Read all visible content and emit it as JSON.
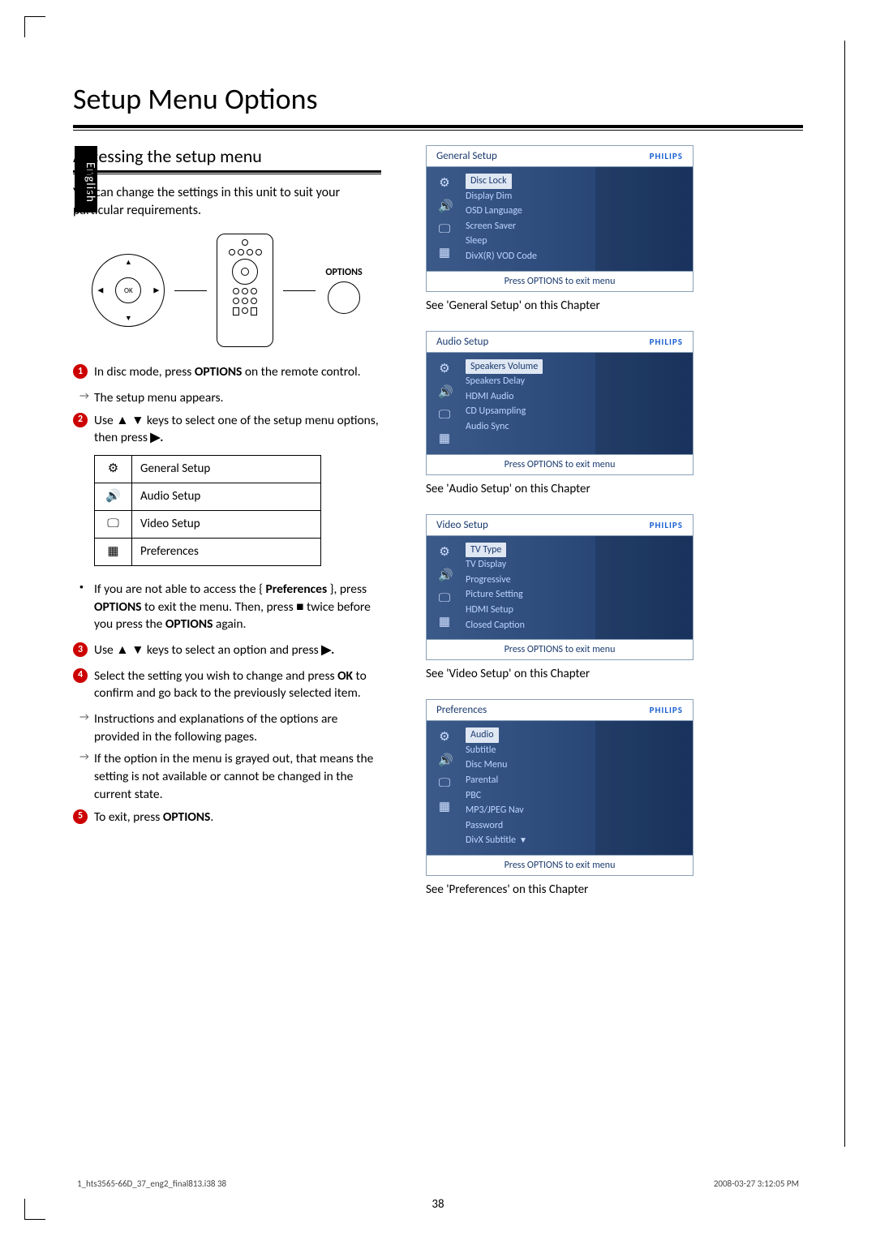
{
  "language_tab": "English",
  "page_title": "Setup Menu Options",
  "section_heading": "Accessing the setup menu",
  "intro_text": "You can change the settings in this unit to suit your particular requirements.",
  "remote": {
    "ok_label": "OK",
    "options_label": "OPTIONS",
    "arrows": {
      "up": "▲",
      "down": "▼",
      "left": "◀",
      "right": "▶"
    }
  },
  "steps": {
    "s1_a": "In disc mode, press ",
    "s1_b": "OPTIONS",
    "s1_c": " on the remote control.",
    "s1_sub": "The setup menu appears.",
    "s2_a": "Use ",
    "s2_keys": "▲ ▼",
    "s2_b": " keys to select one of the setup menu options, then press ",
    "s2_key2": "▶.",
    "note_a": "If you are not able to access the { ",
    "note_b": "Preferences",
    "note_c": " }, press ",
    "note_d": "OPTIONS",
    "note_e": " to exit the menu.  Then, press ",
    "note_stop": "■",
    "note_f": " twice before you press the ",
    "note_g": "OPTIONS",
    "note_h": " again.",
    "s3_a": "Use ",
    "s3_keys": "▲ ▼",
    "s3_b": " keys to select an option and press ",
    "s3_key2": "▶.",
    "s4_a": "Select the setting you wish to change and press ",
    "s4_b": "OK",
    "s4_c": " to confirm and go back to the previously selected item.",
    "s4_sub1": "Instructions and explanations of the options are provided in the following pages.",
    "s4_sub2": "If the option in the menu is grayed out, that means the setting is not available or cannot be changed in the current state.",
    "s5_a": "To exit, press ",
    "s5_b": "OPTIONS",
    "s5_c": "."
  },
  "category_table": [
    {
      "icon": "⚙",
      "label": "General Setup"
    },
    {
      "icon": "🔊",
      "label": "Audio Setup"
    },
    {
      "icon": "🖵",
      "label": "Video Setup"
    },
    {
      "icon": "▦",
      "label": "Preferences"
    }
  ],
  "brand": "PHILIPS",
  "exit_hint": "Press OPTIONS to exit menu",
  "sidebar_icons": [
    "⚙",
    "🔊",
    "🖵",
    "▦"
  ],
  "menus": [
    {
      "title": "General Setup",
      "items": [
        "Disc Lock",
        "Display Dim",
        "OSD Language",
        "Screen Saver",
        "Sleep",
        "DivX(R) VOD Code"
      ],
      "highlight": 0,
      "caption": "See 'General Setup' on this Chapter"
    },
    {
      "title": "Audio Setup",
      "items": [
        "Speakers Volume",
        "Speakers Delay",
        "HDMI Audio",
        "CD Upsampling",
        "Audio Sync"
      ],
      "highlight": 0,
      "caption": "See 'Audio Setup' on this Chapter"
    },
    {
      "title": "Video Setup",
      "items": [
        "TV Type",
        "TV Display",
        "Progressive",
        "Picture Setting",
        "HDMI Setup",
        "Closed Caption"
      ],
      "highlight": 0,
      "caption": "See 'Video Setup' on this Chapter"
    },
    {
      "title": "Preferences",
      "items": [
        "Audio",
        "Subtitle",
        "Disc Menu",
        "Parental",
        "PBC",
        "MP3/JPEG Nav",
        "Password",
        "DivX Subtitle"
      ],
      "highlight": 0,
      "more_arrow": true,
      "caption": "See 'Preferences' on this Chapter"
    }
  ],
  "page_number": "38",
  "footer_left": "1_hts3565-66D_37_eng2_final813.i38   38",
  "footer_right": "2008-03-27   3:12:05 PM"
}
